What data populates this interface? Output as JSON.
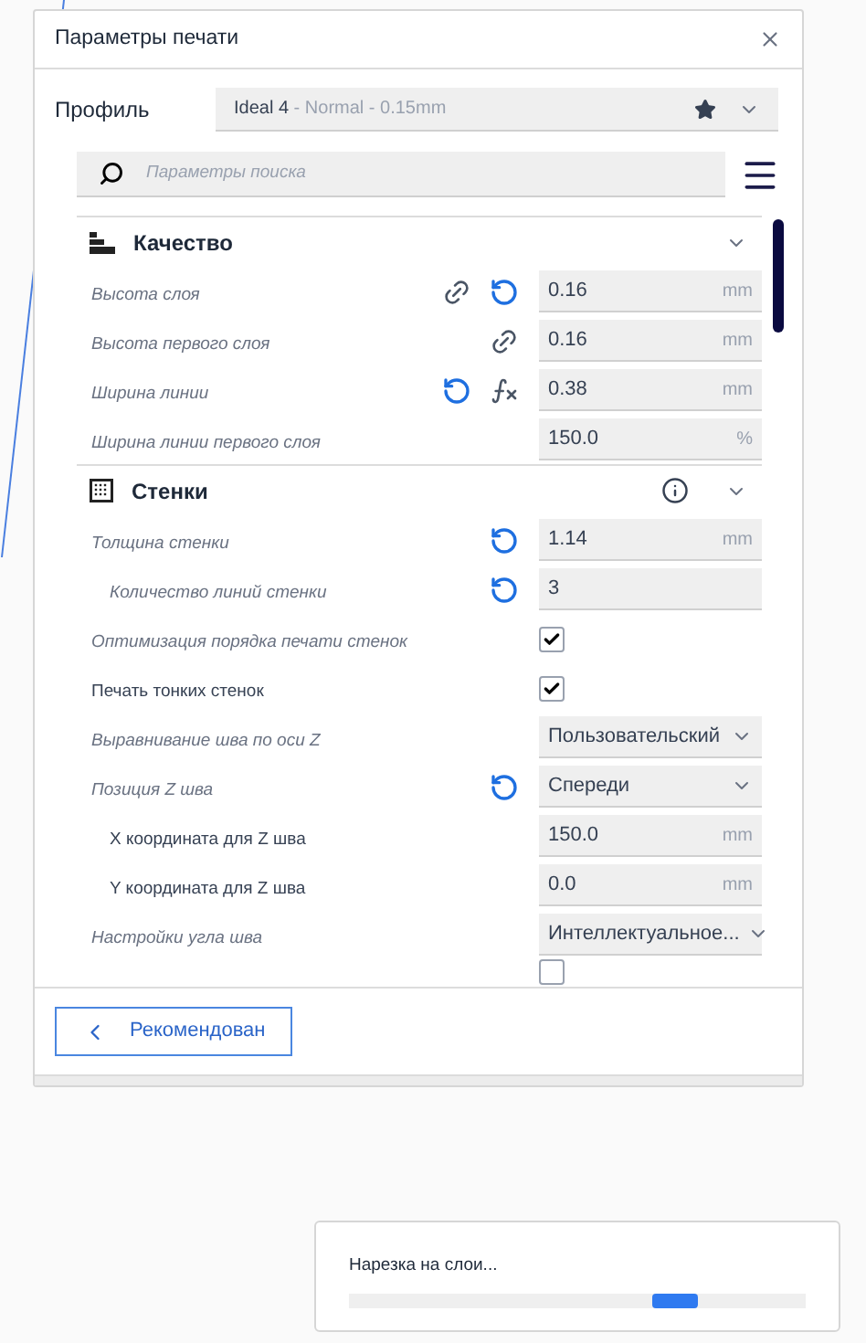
{
  "window": {
    "title": "Параметры печати"
  },
  "profile": {
    "label": "Профиль",
    "name": "Ideal 4",
    "detail": " - Normal - 0.15mm",
    "favorite": true
  },
  "search": {
    "placeholder": "Параметры поиска"
  },
  "sections": [
    {
      "title": "Качество",
      "kind": "quality",
      "info": false,
      "expanded": true,
      "settings": [
        {
          "kind": "number",
          "label": "Высота слоя",
          "italic": true,
          "linked": true,
          "resettable": true,
          "value": "0.16",
          "unit": "mm"
        },
        {
          "kind": "number",
          "label": "Высота первого слоя",
          "italic": true,
          "linked": true,
          "value": "0.16",
          "unit": "mm"
        },
        {
          "kind": "number",
          "label": "Ширина линии",
          "italic": true,
          "resettable": true,
          "formula": true,
          "value": "0.38",
          "unit": "mm"
        },
        {
          "kind": "number",
          "label": "Ширина линии первого слоя",
          "italic": true,
          "value": "150.0",
          "unit": "%"
        }
      ]
    },
    {
      "title": "Стенки",
      "kind": "walls",
      "info": true,
      "expanded": true,
      "settings": [
        {
          "kind": "number",
          "label": "Толщина стенки",
          "italic": true,
          "resettable": true,
          "value": "1.14",
          "unit": "mm",
          "children": [
            {
              "kind": "number",
              "label": "Количество линий стенки",
              "italic": true,
              "resettable": true,
              "value": "3"
            }
          ]
        },
        {
          "kind": "checkbox",
          "label": "Оптимизация порядка печати стенок",
          "italic": true,
          "checked": true
        },
        {
          "kind": "checkbox",
          "label": "Печать тонких стенок",
          "italic": false,
          "checked": true
        },
        {
          "kind": "select",
          "label": "Выравнивание шва по оси Z",
          "italic": true,
          "value": "Пользовательский"
        },
        {
          "kind": "select",
          "label": "Позиция Z шва",
          "italic": true,
          "resettable": true,
          "value": "Спереди",
          "children": [
            {
              "kind": "number",
              "label": "X координата для Z шва",
              "italic": false,
              "value": "150.0",
              "unit": "mm"
            },
            {
              "kind": "number",
              "label": "Y координата для Z шва",
              "italic": false,
              "value": "0.0",
              "unit": "mm"
            }
          ]
        },
        {
          "kind": "select",
          "label": "Настройки угла шва",
          "italic": true,
          "value": "Интеллектуальное..."
        },
        {
          "kind": "checkbox",
          "checked": false
        }
      ]
    }
  ],
  "footer": {
    "button": "Рекомендован"
  },
  "progress": {
    "message": "Нарезка на слои..."
  }
}
